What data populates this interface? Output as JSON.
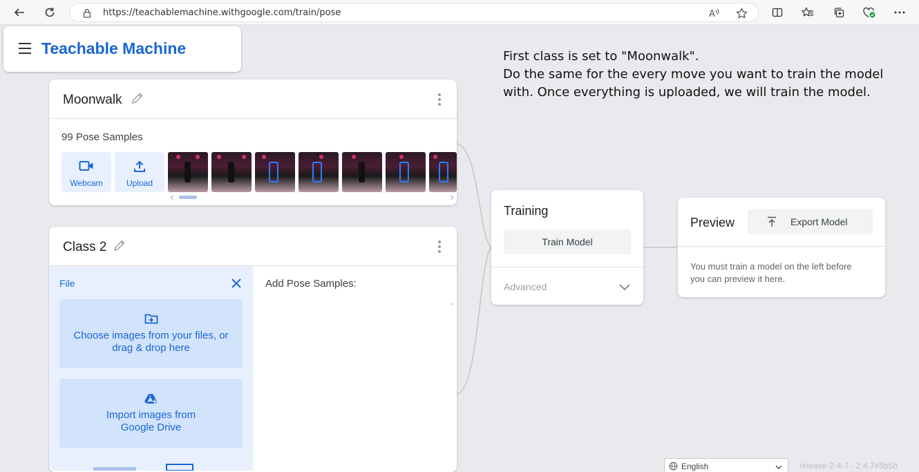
{
  "browser": {
    "url": "https://teachablemachine.withgoogle.com/train/pose"
  },
  "app": {
    "brand": "Teachable Machine"
  },
  "annotation": {
    "line1": "First class is set to \"Moonwalk\".",
    "line2": "Do the same for the every move you want to train the model with. Once everything is uploaded, we will train the model."
  },
  "class1": {
    "name": "Moonwalk",
    "samples_label": "99 Pose Samples",
    "webcam_label": "Webcam",
    "upload_label": "Upload",
    "thumbnail_count": 7
  },
  "class2": {
    "name": "Class 2",
    "panel_title": "File",
    "choose_files": "Choose images from your files, or drag & drop here",
    "import_drive": "Import images from Google Drive",
    "add_samples": "Add Pose Samples:"
  },
  "training": {
    "title": "Training",
    "train_button": "Train Model",
    "advanced": "Advanced"
  },
  "preview": {
    "title": "Preview",
    "export_button": "Export Model",
    "message": "You must train a model on the left before you can preview it here."
  },
  "footer": {
    "language": "English",
    "release": "release-2-4-7 - 2.4.7#5b5b"
  },
  "colors": {
    "accent": "#1967d2",
    "panel_bg": "#e8f0fe",
    "drop_bg": "#d2e3fc",
    "page_bg": "#e8eaed"
  }
}
